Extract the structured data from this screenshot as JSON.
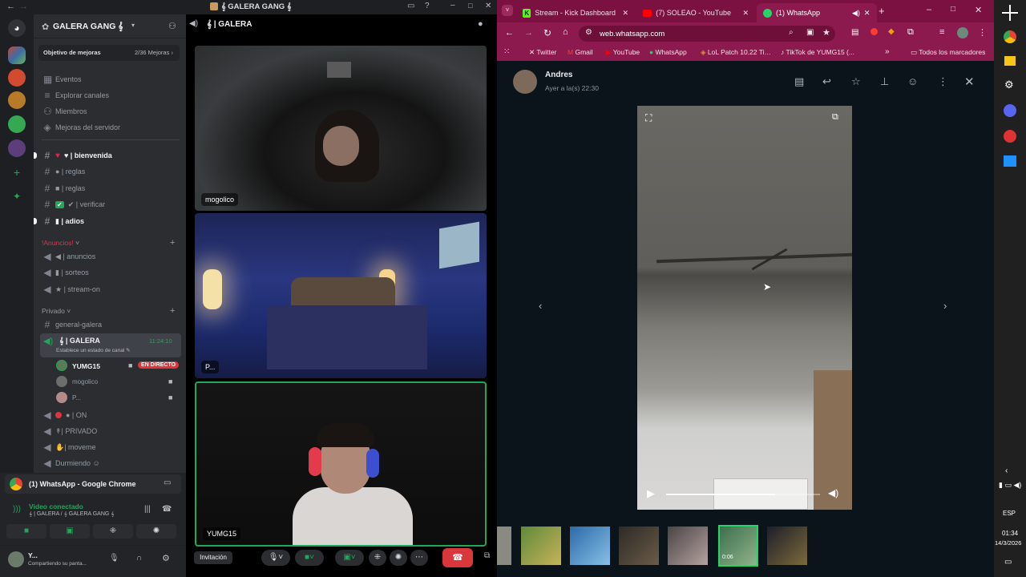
{
  "discord": {
    "window_title": "𝄞 GALERA GANG 𝄞",
    "server_name": "GALERA GANG 𝄞",
    "boost_goal": {
      "label": "Objetivo de mejoras",
      "count": "2/36 Mejoras ›"
    },
    "menu": [
      "Eventos",
      "Explorar canales",
      "Miembros",
      "Mejoras del servidor"
    ],
    "channels_top": [
      {
        "icon": "#",
        "label": "♥ | bienvenida",
        "bold": true
      },
      {
        "icon": "#",
        "label": "● | reglas",
        "bold": false
      },
      {
        "icon": "#",
        "label": "■ | reglas",
        "bold": false
      },
      {
        "icon": "#",
        "label": "✔ | verificar",
        "bold": false
      },
      {
        "icon": "#",
        "label": "▮ | adios",
        "bold": true
      }
    ],
    "category_announcements": "!Anuncios!",
    "announcement_channels": [
      "◀ | anuncios",
      "▮ | sorteos",
      "★ | stream-on"
    ],
    "category_private": "Privado",
    "private_text_channel": "general-galera",
    "voice_channel": {
      "name": "𝄞 | GALERA",
      "timer": "11:24:10",
      "status": "Establece un estado de canal ✎",
      "members": [
        {
          "name": "YUMG15",
          "badge": "EN DIRECTO"
        },
        {
          "name": "mogolico",
          "badge": ""
        },
        {
          "name": "P...",
          "badge": ""
        }
      ]
    },
    "other_voice_channels": [
      "● | ON",
      "↟| PRIVADO",
      "✋| moveme",
      "Durmiendo ☺"
    ],
    "stream_panel": {
      "title": "(1) WhatsApp - Google Chrome"
    },
    "voice_status": {
      "title": "Video conectado",
      "subtitle": "𝄞 | GALERA / 𝄞 GALERA GANG 𝄞"
    },
    "user": {
      "name": "Y...",
      "status": "Compartiendo su panta..."
    },
    "call": {
      "tiles": [
        {
          "name": "mogolico"
        },
        {
          "name": "P..."
        },
        {
          "name": "YUMG15"
        }
      ],
      "invite_label": "Invitación"
    }
  },
  "chrome": {
    "tabs": [
      {
        "label": "Stream - Kick Dashboard",
        "icon": "kick-icon"
      },
      {
        "label": "(7) SOLEAO - YouTube",
        "icon": "youtube-icon"
      },
      {
        "label": "(1) WhatsApp",
        "icon": "whatsapp-icon"
      }
    ],
    "url": "web.whatsapp.com",
    "bookmarks": [
      "Twitter",
      "Gmail",
      "YouTube",
      "WhatsApp",
      "LoL Patch 10.22 Tier...",
      "TikTok de YUMG15 (..."
    ],
    "bookmarks_all": "Todos los marcadores",
    "whatsapp": {
      "sender": "Andres",
      "time": "Ayer a la(s) 22:30",
      "video_progress": 0.71,
      "thumb_badge": "0:06"
    }
  },
  "taskbar": {
    "lang": "ESP",
    "time": "01:34",
    "date": "14/3/2026"
  }
}
